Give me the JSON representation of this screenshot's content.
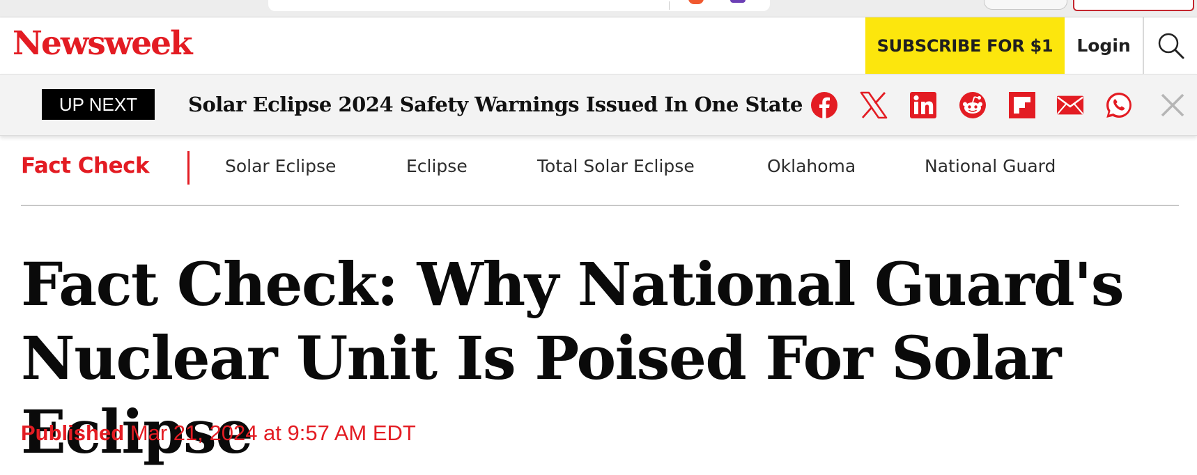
{
  "header": {
    "logo": "Newsweek",
    "subscribe_label": "SUBSCRIBE FOR $1",
    "login_label": "Login"
  },
  "up_next": {
    "badge": "UP NEXT",
    "title": "Solar Eclipse 2024 Safety Warnings Issued In One State",
    "share_icons": [
      "facebook-icon",
      "x-icon",
      "linkedin-icon",
      "reddit-icon",
      "flipboard-icon",
      "email-icon",
      "whatsapp-icon",
      "close-icon"
    ]
  },
  "topics": {
    "primary": "Fact Check",
    "links": [
      "Solar Eclipse",
      "Eclipse",
      "Total Solar Eclipse",
      "Oklahoma",
      "National Guard"
    ]
  },
  "article": {
    "headline": "Fact Check: Why National Guard's Nuclear Unit Is Poised For Solar Eclipse",
    "published_label": "Published",
    "published_date": "Mar 21, 2024 at 9:57 AM EDT"
  },
  "colors": {
    "brand_red": "#e31c23",
    "subscribe_yellow": "#fce60d",
    "badge_black": "#000000",
    "bar_gray": "#f3f3f3"
  }
}
